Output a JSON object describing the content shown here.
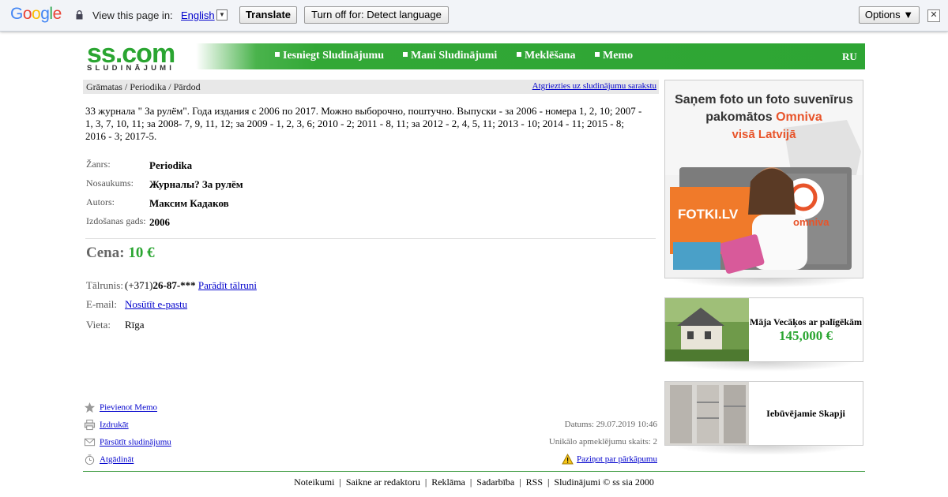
{
  "translate_bar": {
    "logo_letters": [
      {
        "ch": "G",
        "color": "#4285f4"
      },
      {
        "ch": "o",
        "color": "#ea4335"
      },
      {
        "ch": "o",
        "color": "#fbbc05"
      },
      {
        "ch": "g",
        "color": "#4285f4"
      },
      {
        "ch": "l",
        "color": "#34a853"
      },
      {
        "ch": "e",
        "color": "#ea4335"
      }
    ],
    "view_text": "View this page in:",
    "language": "English",
    "dropdown_glyph": "▼",
    "translate_label": "Translate",
    "turn_off_label": "Turn off for: Detect language",
    "options_label": "Options ▼",
    "close_glyph": "✕"
  },
  "header": {
    "logo_main": "ss.com",
    "logo_sub": "SLUDINĀJUMI",
    "nav": [
      "Iesniegt Sludinājumu",
      "Mani Sludinājumi",
      "Meklēšana",
      "Memo"
    ],
    "lang": "RU"
  },
  "breadcrumb": {
    "path": "Grāmatas / Periodika / Pārdod",
    "back_link": "Atgriezties uz sludinājumu sarakstu"
  },
  "listing": {
    "description": "33 журнала \" За рулём\". Года издания с 2006 по 2017. Можно выборочно, поштучно. Выпуски - за 2006 - номера 1, 2, 10; 2007 - 1, 3, 7, 10, 11; за 2008- 7, 9, 11, 12; за 2009 - 1, 2, 3, 6; 2010 - 2; 2011 - 8, 11; за 2012 - 2, 4, 5, 11; 2013 - 10; 2014 - 11; 2015 - 8; 2016 - 3; 2017-5.",
    "fields": [
      {
        "label": "Žanrs:",
        "value": "Periodika"
      },
      {
        "label": "Nosaukums:",
        "value": "Журналы? За рулём"
      },
      {
        "label": "Autors:",
        "value": "Максим Кадаков"
      },
      {
        "label": "Izdošanas gads:",
        "value": "2006"
      }
    ],
    "price_label": "Cena:",
    "price_value": "10 €",
    "phone_label": "Tālrunis:",
    "phone_prefix": "(+371)",
    "phone_number": "26-87-***",
    "phone_link": "Parādīt tālruni",
    "email_label": "E-mail:",
    "email_link": "Nosūtīt e-pastu",
    "place_label": "Vieta:",
    "place_value": "Rīga"
  },
  "actions": {
    "memo": "Pievienot Memo",
    "print": "Izdrukāt",
    "forward": "Pārsūtīt sludinājumu",
    "remind": "Atgādināt"
  },
  "meta": {
    "date": "Datums: 29.07.2019 10:46",
    "visits": "Unikālo apmeklējumu skaits: 2",
    "report": "Paziņot par pārkāpumu"
  },
  "footer": "Noteikumi  |  Saikne ar redaktoru  |  Reklāma  |  Sadarbība  |  RSS  |  Sludinājumi © ss sia 2000",
  "ads": {
    "big": {
      "line1": "Saņem foto un foto suvenīrus",
      "line2_a": "pakomātos ",
      "line2_b": "Omniva",
      "line3": "visā Latvijā",
      "fotki": "FOTKI.LV",
      "omniva": "omniva"
    },
    "house": {
      "title": "Māja Vecāķos ar palīgēkām",
      "price": "145,000 €"
    },
    "wardrobe": {
      "title": "Iebūvējamie Skapji"
    }
  }
}
